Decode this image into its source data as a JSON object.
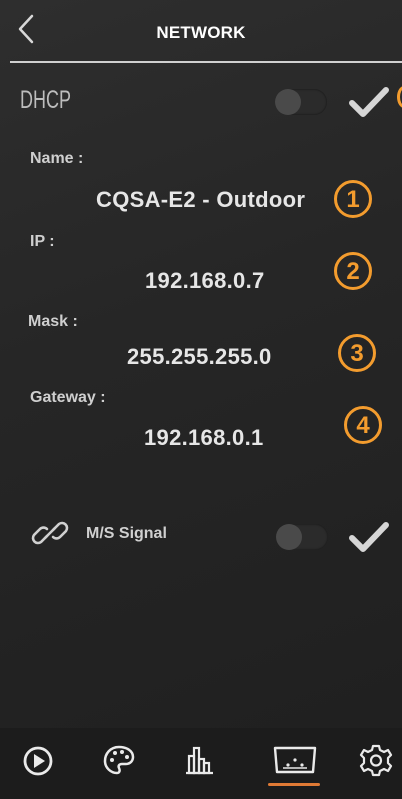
{
  "header": {
    "title": "NETWORK"
  },
  "dhcp": {
    "label": "DHCP",
    "enabled": false
  },
  "fields": [
    {
      "label": "Name :",
      "value": "CQSA-E2 - Outdoor",
      "badge": "1"
    },
    {
      "label": "IP :",
      "value": "192.168.0.7",
      "badge": "2"
    },
    {
      "label": "Mask :",
      "value": "255.255.255.0",
      "badge": "3"
    },
    {
      "label": "Gateway :",
      "value": "192.168.0.1",
      "badge": "4"
    }
  ],
  "ms_signal": {
    "label": "M/S Signal",
    "enabled": false
  },
  "nav": {
    "items": [
      {
        "icon": "play-circle-icon"
      },
      {
        "icon": "palette-icon"
      },
      {
        "icon": "bar-chart-icon"
      },
      {
        "icon": "display-screen-icon",
        "active": true
      },
      {
        "icon": "gear-icon"
      }
    ]
  },
  "colors": {
    "accent": "#f39c2e",
    "active_tab": "#e07a35",
    "background": "#262626"
  }
}
